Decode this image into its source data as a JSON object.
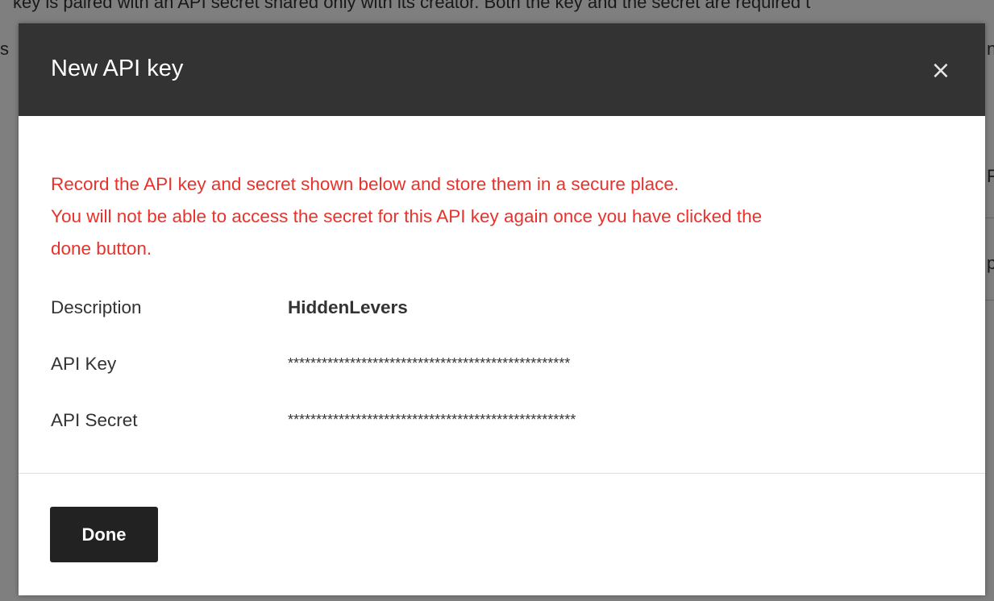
{
  "background": {
    "top_text": "key is paired with an API secret shared only with its creator. Both the key and the secret are required t",
    "side_fragments": [
      "s",
      "n",
      "F",
      "p"
    ]
  },
  "modal": {
    "title": "New API key",
    "close_glyph": "×",
    "warning_lines": [
      "Record the API key and secret shown below and store them in a secure place.",
      "You will not be able to access the secret for this API key again once you have clicked the",
      "done button."
    ],
    "fields": [
      {
        "label": "Description",
        "value": "HiddenLevers"
      },
      {
        "label": "API Key",
        "value": "**************************************************"
      },
      {
        "label": "API Secret",
        "value": "***************************************************"
      }
    ],
    "done_label": "Done"
  },
  "colors": {
    "header_bg": "#333333",
    "warning": "#e8322c",
    "button_bg": "#222222"
  }
}
